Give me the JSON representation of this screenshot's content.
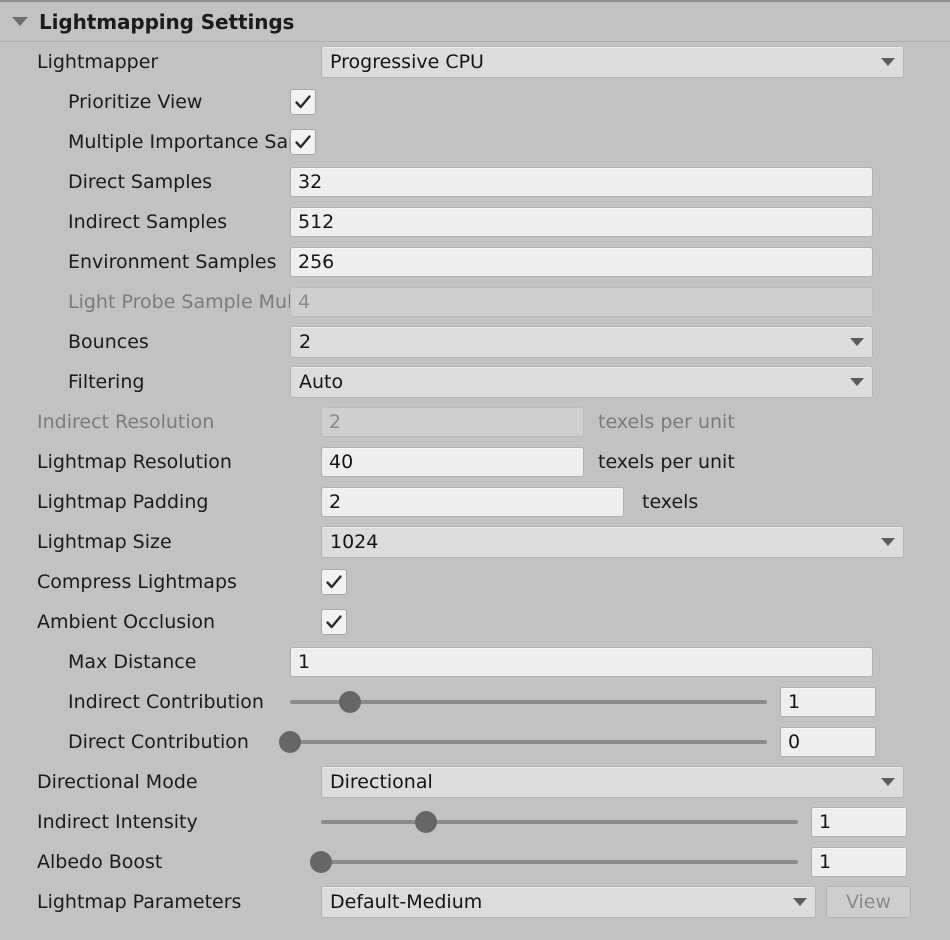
{
  "header": {
    "title": "Lightmapping Settings",
    "foldout_state": "expanded"
  },
  "rows": {
    "lightmapper": {
      "label": "Lightmapper",
      "value": "Progressive CPU"
    },
    "prioritize_view": {
      "label": "Prioritize View",
      "checked": true
    },
    "multiple_importance_sampling": {
      "label": "Multiple Importance San",
      "checked": true
    },
    "direct_samples": {
      "label": "Direct Samples",
      "value": "32"
    },
    "indirect_samples": {
      "label": "Indirect Samples",
      "value": "512"
    },
    "environment_samples": {
      "label": "Environment Samples",
      "value": "256"
    },
    "light_probe_sample_multiplier": {
      "label": "Light Probe Sample Mul",
      "value": "4",
      "disabled": true
    },
    "bounces": {
      "label": "Bounces",
      "value": "2"
    },
    "filtering": {
      "label": "Filtering",
      "value": "Auto"
    },
    "indirect_resolution": {
      "label": "Indirect Resolution",
      "value": "2",
      "suffix": "texels per unit",
      "disabled": true
    },
    "lightmap_resolution": {
      "label": "Lightmap Resolution",
      "value": "40",
      "suffix": "texels per unit"
    },
    "lightmap_padding": {
      "label": "Lightmap Padding",
      "value": "2",
      "suffix": "texels"
    },
    "lightmap_size": {
      "label": "Lightmap Size",
      "value": "1024"
    },
    "compress_lightmaps": {
      "label": "Compress Lightmaps",
      "checked": true
    },
    "ambient_occlusion": {
      "label": "Ambient Occlusion",
      "checked": true
    },
    "max_distance": {
      "label": "Max Distance",
      "value": "1"
    },
    "indirect_contribution": {
      "label": "Indirect Contribution",
      "value": "1",
      "slider_percent": 12.5
    },
    "direct_contribution": {
      "label": "Direct Contribution",
      "value": "0",
      "slider_percent": 0
    },
    "directional_mode": {
      "label": "Directional Mode",
      "value": "Directional"
    },
    "indirect_intensity": {
      "label": "Indirect Intensity",
      "value": "1",
      "slider_percent": 22
    },
    "albedo_boost": {
      "label": "Albedo Boost",
      "value": "1",
      "slider_percent": 0
    },
    "lightmap_parameters": {
      "label": "Lightmap Parameters",
      "value": "Default-Medium",
      "button_label": "View",
      "button_disabled": true
    }
  },
  "colors": {
    "panel_background": "#c2c2c2",
    "field_background": "#eeeeee",
    "field_disabled_background": "#cfcfcf",
    "dropdown_background": "#dcdcdc",
    "text": "#1b1b1b",
    "text_disabled": "#7b7b7b",
    "slider_track": "#8c8c8c",
    "slider_handle": "#666666"
  }
}
